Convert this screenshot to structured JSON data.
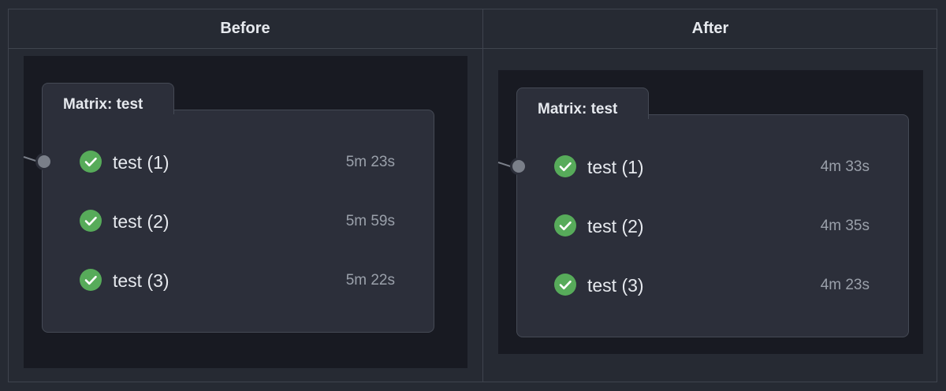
{
  "columns": {
    "before": {
      "header": "Before",
      "matrix_title": "Matrix: test",
      "jobs": [
        {
          "name": "test (1)",
          "duration": "5m 23s",
          "status": "success"
        },
        {
          "name": "test (2)",
          "duration": "5m 59s",
          "status": "success"
        },
        {
          "name": "test (3)",
          "duration": "5m 22s",
          "status": "success"
        }
      ]
    },
    "after": {
      "header": "After",
      "matrix_title": "Matrix: test",
      "jobs": [
        {
          "name": "test (1)",
          "duration": "4m 33s",
          "status": "success"
        },
        {
          "name": "test (2)",
          "duration": "4m 35s",
          "status": "success"
        },
        {
          "name": "test (3)",
          "duration": "4m 23s",
          "status": "success"
        }
      ]
    }
  },
  "icons": {
    "status_success": "check-circle-icon"
  },
  "colors": {
    "background": "#262a33",
    "panel": "#181a22",
    "card": "#2c2f3a",
    "border": "#454a55",
    "success": "#57ab5a",
    "text": "#e6e9ee",
    "muted": "#9aa0aa"
  }
}
